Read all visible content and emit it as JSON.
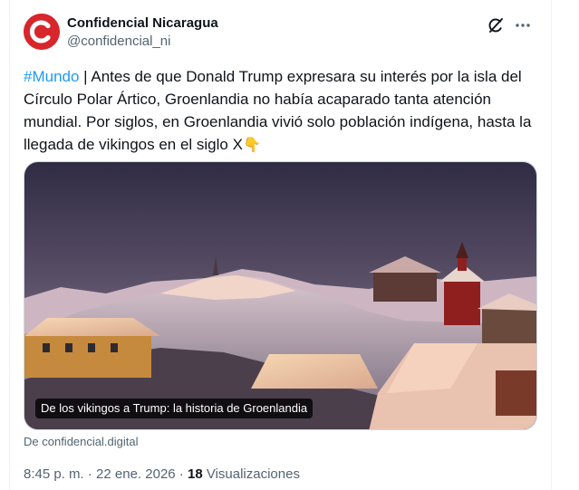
{
  "account": {
    "display_name": "Confidencial Nicaragua",
    "handle": "@confidencial_ni",
    "avatar_letter": "C",
    "avatar_color": "#d7262c"
  },
  "tweet": {
    "hashtag": "#Mundo",
    "text": " | Antes de que Donald Trump expresara su interés por la isla del Círculo Polar Ártico, Groenlandia no había acaparado tanta atención mundial. Por siglos, en Groenlandia vivió solo población indígena, hasta la llegada de vikingos en el siglo X",
    "emoji": "👇"
  },
  "card": {
    "title": "De los vikingos a Trump: la historia de Groenlandia",
    "source": "De confidencial.digital"
  },
  "meta": {
    "time": "8:45 p. m.",
    "separator": " · ",
    "date": "22 ene. 2026",
    "views_count": "18",
    "views_label": " Visualizaciones"
  },
  "colors": {
    "link": "#1d9bf0",
    "text": "#0f1419",
    "secondary": "#536471"
  },
  "icons": [
    "grok-icon",
    "more-icon"
  ]
}
